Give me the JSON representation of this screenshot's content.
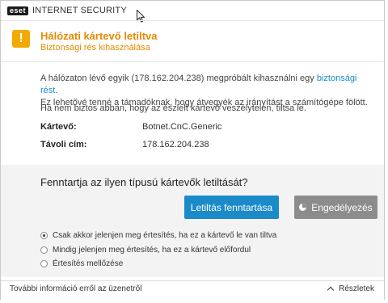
{
  "app": {
    "logo": "eset",
    "product": "INTERNET SECURITY"
  },
  "alert": {
    "title": "Hálózati kártevő letiltva",
    "subtitle": "Biztonsági rés kihasználása",
    "icon_symbol": "!",
    "accent_color": "#e68a00"
  },
  "body": {
    "paragraph1_before": "A hálózaton lévő egyik (178.162.204.238) megpróbált kihasználni egy ",
    "paragraph1_link": "biztonsági rést",
    "paragraph1_after": ".",
    "paragraph1_line2": "Ez lehetővé tenné a támadóknak, hogy átvegyék az irányítást a számítógépe fölött.",
    "paragraph2": "Ha nem biztos abban, hogy az észlelt kártevő veszélytelen, tiltsa le.",
    "details": [
      {
        "label": "Kártevő:",
        "value": "Botnet.CnC.Generic"
      },
      {
        "label": "Távoli cím:",
        "value": "178.162.204.238"
      }
    ]
  },
  "action": {
    "question": "Fenntartja az ilyen típusú kártevők letiltását?",
    "primary_label": "Letiltás fenntartása",
    "secondary_label": "Engedélyezés",
    "primary_color": "#1a8ac9",
    "secondary_color": "#8c8c8c"
  },
  "options": [
    {
      "label": "Csak akkor jelenjen meg értesítés, ha ez a kártevő le van tiltva",
      "checked": true
    },
    {
      "label": "Mindig jelenjen meg értesítés, ha ez a kártevő előfordul",
      "checked": false
    },
    {
      "label": "Értesítés mellőzése",
      "checked": false
    }
  ],
  "footer": {
    "more_info": "További információ erről az üzenetről",
    "details_toggle": "Részletek"
  }
}
